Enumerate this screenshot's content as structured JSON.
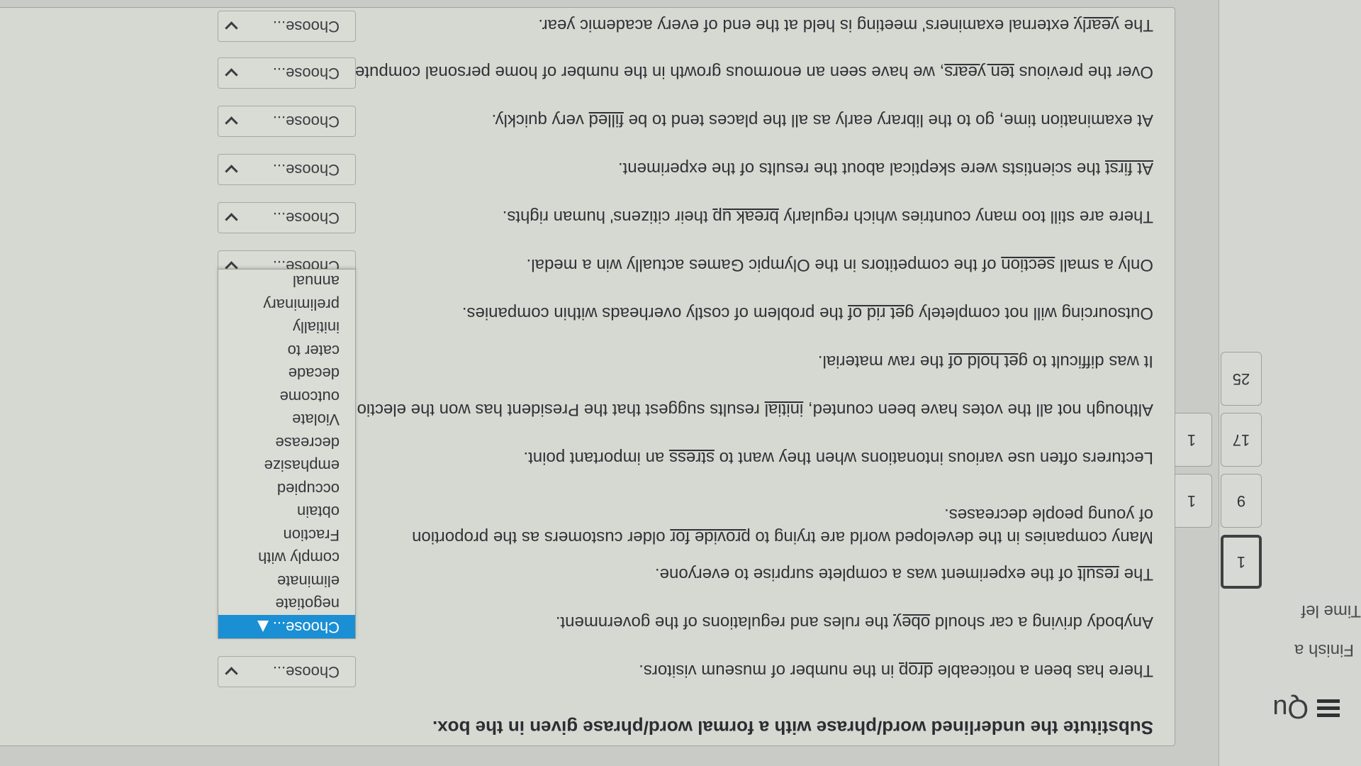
{
  "nav": {
    "title": "Qu",
    "finish_text": "Finish a",
    "time_left": "Time lef",
    "questions": [
      "1",
      "9",
      "17",
      "25",
      "1",
      "1"
    ]
  },
  "instructions": "Substitute the underlined word/phrase with a formal word/phrase given in the box.",
  "select_placeholder": "Choose...",
  "questions": [
    {
      "before": "There has been a noticeable ",
      "u": "drop",
      "after": " in the number of museum visitors.",
      "select": "Choose..."
    },
    {
      "before": "Anybody driving a car should ",
      "u": "obey",
      "after": " the rules and regulations of the government.",
      "select": "Choose..."
    },
    {
      "before": "The ",
      "u": "result",
      "after": " of the experiment was a complete surprise to everyone.",
      "select": ""
    },
    {
      "before": "Many companies in the developed world are trying to ",
      "u": "provide for",
      "after": " older customers as the proportion of young people decreases.",
      "select": ""
    },
    {
      "before": "Lecturers often use various intonations when they want to ",
      "u": "stress",
      "after": " an important point.",
      "select": ""
    },
    {
      "before": "Although not all the votes have been counted, ",
      "u": "initial",
      "after": " results suggest that the President has won the election.",
      "select": ""
    },
    {
      "before": "It was difficult to ",
      "u": "get hold of",
      "after": " the raw material.",
      "select": ""
    },
    {
      "before": "Outsourcing will not completely ",
      "u": "get rid of",
      "after": " the problem of costly overheads within companies.",
      "select": ""
    },
    {
      "before": "Only a small ",
      "u": "section",
      "after": " of the competitors in the Olympic Games actually win a medal.",
      "select": "Choose..."
    },
    {
      "before": "There are still too many countries which regularly ",
      "u": "break up",
      "after": " their citizens' human rights.",
      "select": "Choose..."
    },
    {
      "before": "",
      "u": "At first",
      "after": " the scientists were skeptical about the results of the experiment.",
      "select": "Choose..."
    },
    {
      "before": "At examination time, go to the library early as all the places tend to be ",
      "u": "filled",
      "after": " very quickly.",
      "select": "Choose..."
    },
    {
      "before": "Over the previous ",
      "u": "ten years",
      "after": ", we have seen an enormous growth in the number of home personal computers.",
      "select": "Choose..."
    },
    {
      "before": "The ",
      "u": "yearly",
      "after": " external examiners' meeting is held at the end of every academic year.",
      "select": "Choose..."
    }
  ],
  "dropdown_options": [
    "Choose...",
    "negotiate",
    "eliminate",
    "comply with",
    "Fraction",
    "obtain",
    "occupied",
    "emphasize",
    "decrease",
    "Violate",
    "outcome",
    "decade",
    "cater to",
    "initially",
    "preliminary",
    "annual"
  ],
  "highlighted_option": "Choose..."
}
